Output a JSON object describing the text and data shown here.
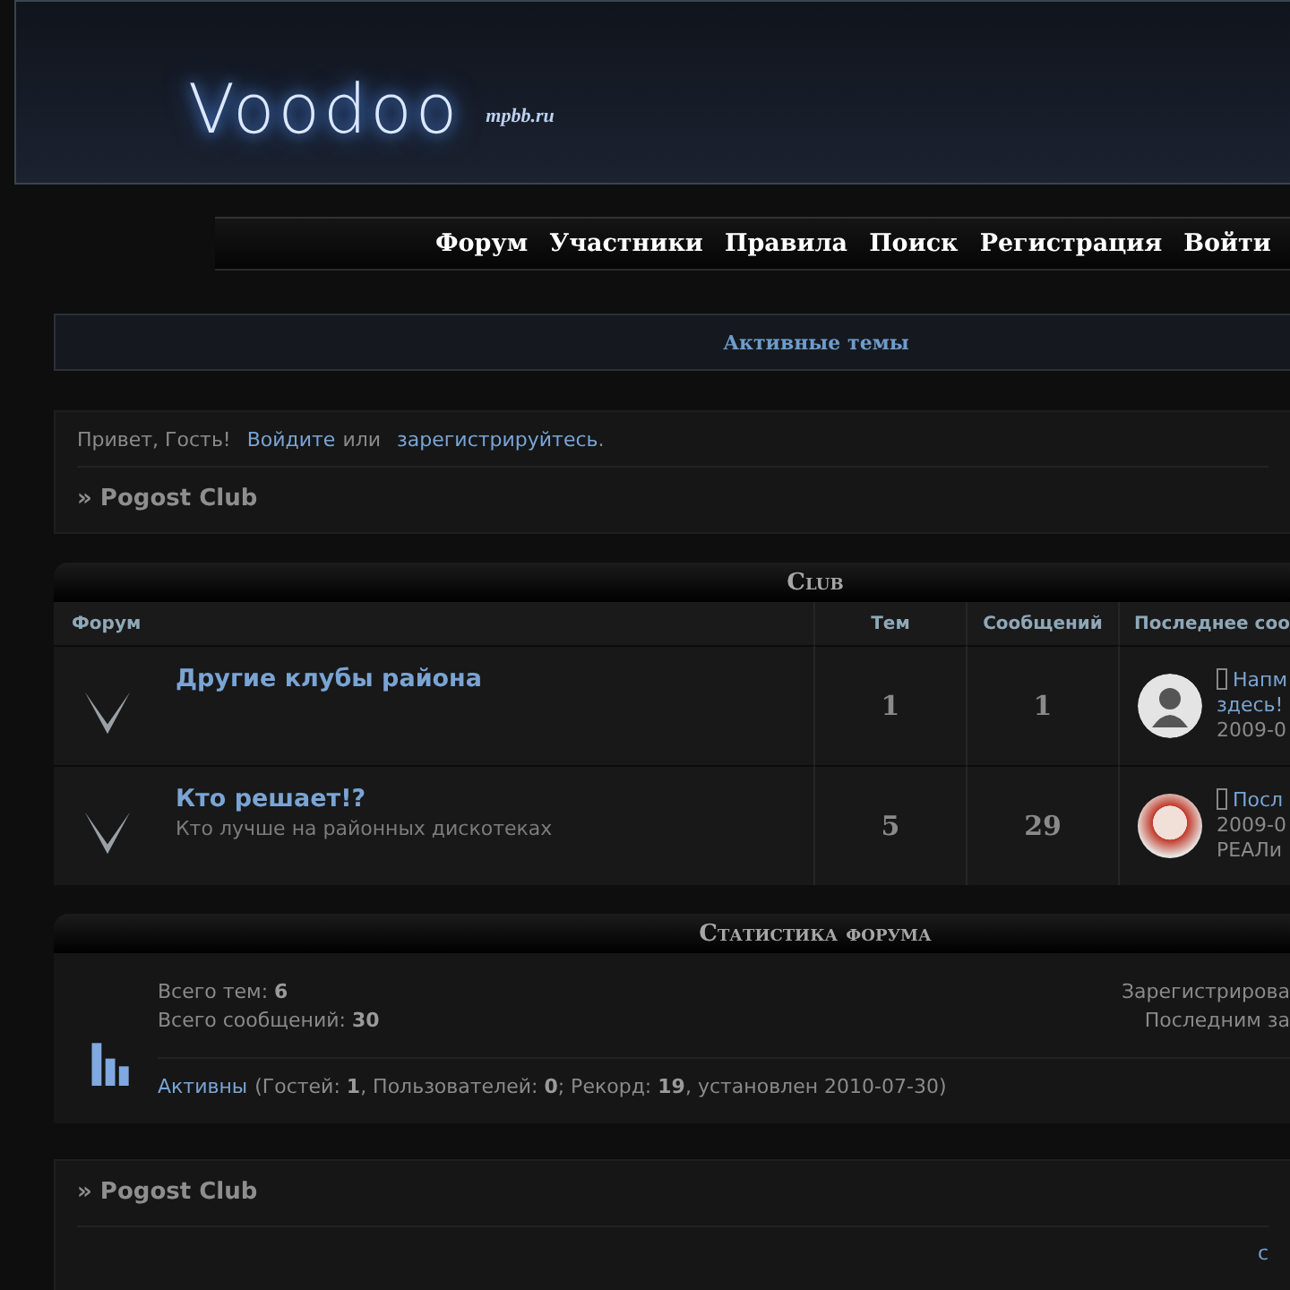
{
  "header": {
    "logo": "Voodoo",
    "logo_sub": "mpbb.ru"
  },
  "nav": [
    {
      "label": "Форум"
    },
    {
      "label": "Участники"
    },
    {
      "label": "Правила"
    },
    {
      "label": "Поиск"
    },
    {
      "label": "Регистрация"
    },
    {
      "label": "Войти"
    }
  ],
  "active_topics": "Активные темы",
  "welcome": {
    "greeting": "Привет, Гость!",
    "login": "Войдите",
    "or": "или",
    "register": "зарегистрируйтесь",
    "end": "."
  },
  "breadcrumb_top": "» Pogost Club",
  "category": {
    "title": "Club",
    "columns": [
      "Форум",
      "Тем",
      "Сообщений",
      "Последнее соо"
    ],
    "rows": [
      {
        "name": "Другие клубы района",
        "description": "",
        "topics": "1",
        "posts": "1",
        "avatar": {
          "kind": "silhouette"
        },
        "last_lines": [
          {
            "kind": "link",
            "text": "Напм"
          },
          {
            "kind": "link",
            "text": "здесь!"
          },
          {
            "kind": "plain",
            "text": "2009-0"
          }
        ]
      },
      {
        "name": "Кто решает!?",
        "description": "Кто лучше на районных дискотеках",
        "topics": "5",
        "posts": "29",
        "avatar": {
          "kind": "photo"
        },
        "last_lines": [
          {
            "kind": "link",
            "text": "Посл"
          },
          {
            "kind": "plain",
            "text": "2009-0"
          },
          {
            "kind": "plain",
            "text": "РЕАЛи"
          }
        ]
      }
    ]
  },
  "stats": {
    "title": "Статистика форума",
    "topics": "Всего тем: **6**",
    "posts": "Всего сообщений: **30**",
    "right_lines": [
      "Зарегистрирова",
      "Последним за"
    ],
    "online_link": "Активны",
    "online_text": "(Гостей: **1**, Пользователей: **0**; Рекорд: **19**, установлен 2010-07-30)"
  },
  "breadcrumb_bottom": "» Pogost Club",
  "bottom_link": "с"
}
